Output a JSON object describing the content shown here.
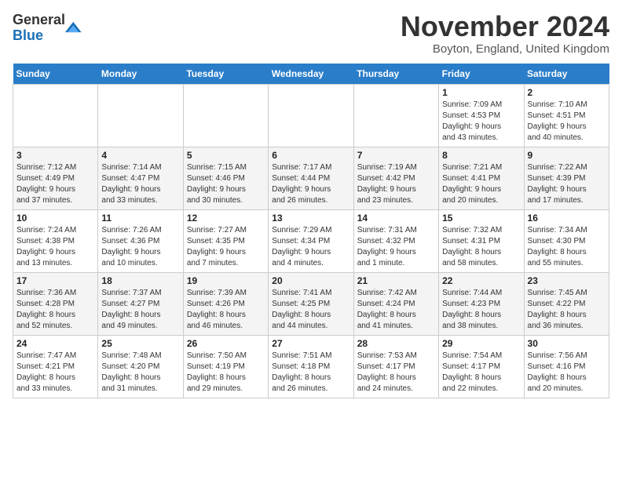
{
  "header": {
    "logo_general": "General",
    "logo_blue": "Blue",
    "month_title": "November 2024",
    "location": "Boyton, England, United Kingdom"
  },
  "days_of_week": [
    "Sunday",
    "Monday",
    "Tuesday",
    "Wednesday",
    "Thursday",
    "Friday",
    "Saturday"
  ],
  "weeks": [
    [
      {
        "day": "",
        "info": ""
      },
      {
        "day": "",
        "info": ""
      },
      {
        "day": "",
        "info": ""
      },
      {
        "day": "",
        "info": ""
      },
      {
        "day": "",
        "info": ""
      },
      {
        "day": "1",
        "info": "Sunrise: 7:09 AM\nSunset: 4:53 PM\nDaylight: 9 hours\nand 43 minutes."
      },
      {
        "day": "2",
        "info": "Sunrise: 7:10 AM\nSunset: 4:51 PM\nDaylight: 9 hours\nand 40 minutes."
      }
    ],
    [
      {
        "day": "3",
        "info": "Sunrise: 7:12 AM\nSunset: 4:49 PM\nDaylight: 9 hours\nand 37 minutes."
      },
      {
        "day": "4",
        "info": "Sunrise: 7:14 AM\nSunset: 4:47 PM\nDaylight: 9 hours\nand 33 minutes."
      },
      {
        "day": "5",
        "info": "Sunrise: 7:15 AM\nSunset: 4:46 PM\nDaylight: 9 hours\nand 30 minutes."
      },
      {
        "day": "6",
        "info": "Sunrise: 7:17 AM\nSunset: 4:44 PM\nDaylight: 9 hours\nand 26 minutes."
      },
      {
        "day": "7",
        "info": "Sunrise: 7:19 AM\nSunset: 4:42 PM\nDaylight: 9 hours\nand 23 minutes."
      },
      {
        "day": "8",
        "info": "Sunrise: 7:21 AM\nSunset: 4:41 PM\nDaylight: 9 hours\nand 20 minutes."
      },
      {
        "day": "9",
        "info": "Sunrise: 7:22 AM\nSunset: 4:39 PM\nDaylight: 9 hours\nand 17 minutes."
      }
    ],
    [
      {
        "day": "10",
        "info": "Sunrise: 7:24 AM\nSunset: 4:38 PM\nDaylight: 9 hours\nand 13 minutes."
      },
      {
        "day": "11",
        "info": "Sunrise: 7:26 AM\nSunset: 4:36 PM\nDaylight: 9 hours\nand 10 minutes."
      },
      {
        "day": "12",
        "info": "Sunrise: 7:27 AM\nSunset: 4:35 PM\nDaylight: 9 hours\nand 7 minutes."
      },
      {
        "day": "13",
        "info": "Sunrise: 7:29 AM\nSunset: 4:34 PM\nDaylight: 9 hours\nand 4 minutes."
      },
      {
        "day": "14",
        "info": "Sunrise: 7:31 AM\nSunset: 4:32 PM\nDaylight: 9 hours\nand 1 minute."
      },
      {
        "day": "15",
        "info": "Sunrise: 7:32 AM\nSunset: 4:31 PM\nDaylight: 8 hours\nand 58 minutes."
      },
      {
        "day": "16",
        "info": "Sunrise: 7:34 AM\nSunset: 4:30 PM\nDaylight: 8 hours\nand 55 minutes."
      }
    ],
    [
      {
        "day": "17",
        "info": "Sunrise: 7:36 AM\nSunset: 4:28 PM\nDaylight: 8 hours\nand 52 minutes."
      },
      {
        "day": "18",
        "info": "Sunrise: 7:37 AM\nSunset: 4:27 PM\nDaylight: 8 hours\nand 49 minutes."
      },
      {
        "day": "19",
        "info": "Sunrise: 7:39 AM\nSunset: 4:26 PM\nDaylight: 8 hours\nand 46 minutes."
      },
      {
        "day": "20",
        "info": "Sunrise: 7:41 AM\nSunset: 4:25 PM\nDaylight: 8 hours\nand 44 minutes."
      },
      {
        "day": "21",
        "info": "Sunrise: 7:42 AM\nSunset: 4:24 PM\nDaylight: 8 hours\nand 41 minutes."
      },
      {
        "day": "22",
        "info": "Sunrise: 7:44 AM\nSunset: 4:23 PM\nDaylight: 8 hours\nand 38 minutes."
      },
      {
        "day": "23",
        "info": "Sunrise: 7:45 AM\nSunset: 4:22 PM\nDaylight: 8 hours\nand 36 minutes."
      }
    ],
    [
      {
        "day": "24",
        "info": "Sunrise: 7:47 AM\nSunset: 4:21 PM\nDaylight: 8 hours\nand 33 minutes."
      },
      {
        "day": "25",
        "info": "Sunrise: 7:48 AM\nSunset: 4:20 PM\nDaylight: 8 hours\nand 31 minutes."
      },
      {
        "day": "26",
        "info": "Sunrise: 7:50 AM\nSunset: 4:19 PM\nDaylight: 8 hours\nand 29 minutes."
      },
      {
        "day": "27",
        "info": "Sunrise: 7:51 AM\nSunset: 4:18 PM\nDaylight: 8 hours\nand 26 minutes."
      },
      {
        "day": "28",
        "info": "Sunrise: 7:53 AM\nSunset: 4:17 PM\nDaylight: 8 hours\nand 24 minutes."
      },
      {
        "day": "29",
        "info": "Sunrise: 7:54 AM\nSunset: 4:17 PM\nDaylight: 8 hours\nand 22 minutes."
      },
      {
        "day": "30",
        "info": "Sunrise: 7:56 AM\nSunset: 4:16 PM\nDaylight: 8 hours\nand 20 minutes."
      }
    ]
  ]
}
